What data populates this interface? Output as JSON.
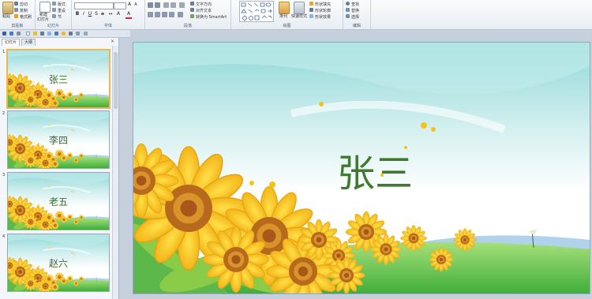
{
  "ribbon": {
    "clipboard": {
      "paste_label": "粘贴",
      "cut_label": "剪切",
      "copy_label": "复制",
      "format_painter_label": "格式刷",
      "group_label": "剪贴板"
    },
    "slides": {
      "new_slide_label": "新建",
      "new_slide_label2": "幻灯片",
      "layout_label": "版式",
      "reset_label": "重设",
      "section_label": "节",
      "group_label": "幻灯片"
    },
    "font": {
      "group_label": "字体"
    },
    "paragraph": {
      "text_direction_label": "文字方向",
      "align_text_label": "对齐文本",
      "convert_smartart_label": "转换为 SmartArt",
      "group_label": "段落"
    },
    "drawing": {
      "arrange_label": "排列",
      "quick_styles_label": "快速样式",
      "shape_fill_label": "形状填充",
      "shape_outline_label": "形状轮廓",
      "shape_effects_label": "形状效果",
      "group_label": "绘图"
    },
    "editing": {
      "find_label": "查找",
      "replace_label": "替换",
      "select_label": "选择",
      "group_label": "编辑"
    }
  },
  "panel": {
    "tab_slides": "幻灯片",
    "tab_outline": "大纲",
    "close_glyph": "×"
  },
  "thumbnails": [
    {
      "number": "1",
      "title": "张三"
    },
    {
      "number": "2",
      "title": "李四"
    },
    {
      "number": "3",
      "title": "老五"
    },
    {
      "number": "4",
      "title": "赵六"
    }
  ],
  "slide": {
    "title": "张三"
  },
  "colors": {
    "title_green": "#3f7a2e",
    "selection_border": "#f0b84c",
    "ribbon_bg": "#eef2f6",
    "workspace_bg": "#c6d0dc"
  }
}
